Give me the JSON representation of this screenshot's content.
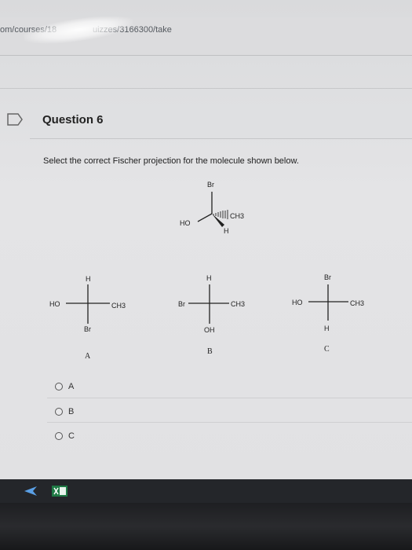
{
  "browser": {
    "url_left": "om/courses/18",
    "url_right": "uizzes/3166300/take"
  },
  "question": {
    "title": "Question 6",
    "prompt": "Select the correct Fischer projection for the molecule shown below."
  },
  "molecule": {
    "top": "Br",
    "left": "HO",
    "right": "CH3",
    "bottom": "H"
  },
  "fischer": [
    {
      "top": "H",
      "left": "HO",
      "right": "CH3",
      "bottom": "Br",
      "label": "A"
    },
    {
      "top": "H",
      "left": "Br",
      "right": "CH3",
      "bottom": "OH",
      "label": "B"
    },
    {
      "top": "Br",
      "left": "HO",
      "right": "CH3",
      "bottom": "H",
      "label": "C"
    }
  ],
  "options": [
    {
      "label": "A"
    },
    {
      "label": "B"
    },
    {
      "label": "C"
    }
  ]
}
